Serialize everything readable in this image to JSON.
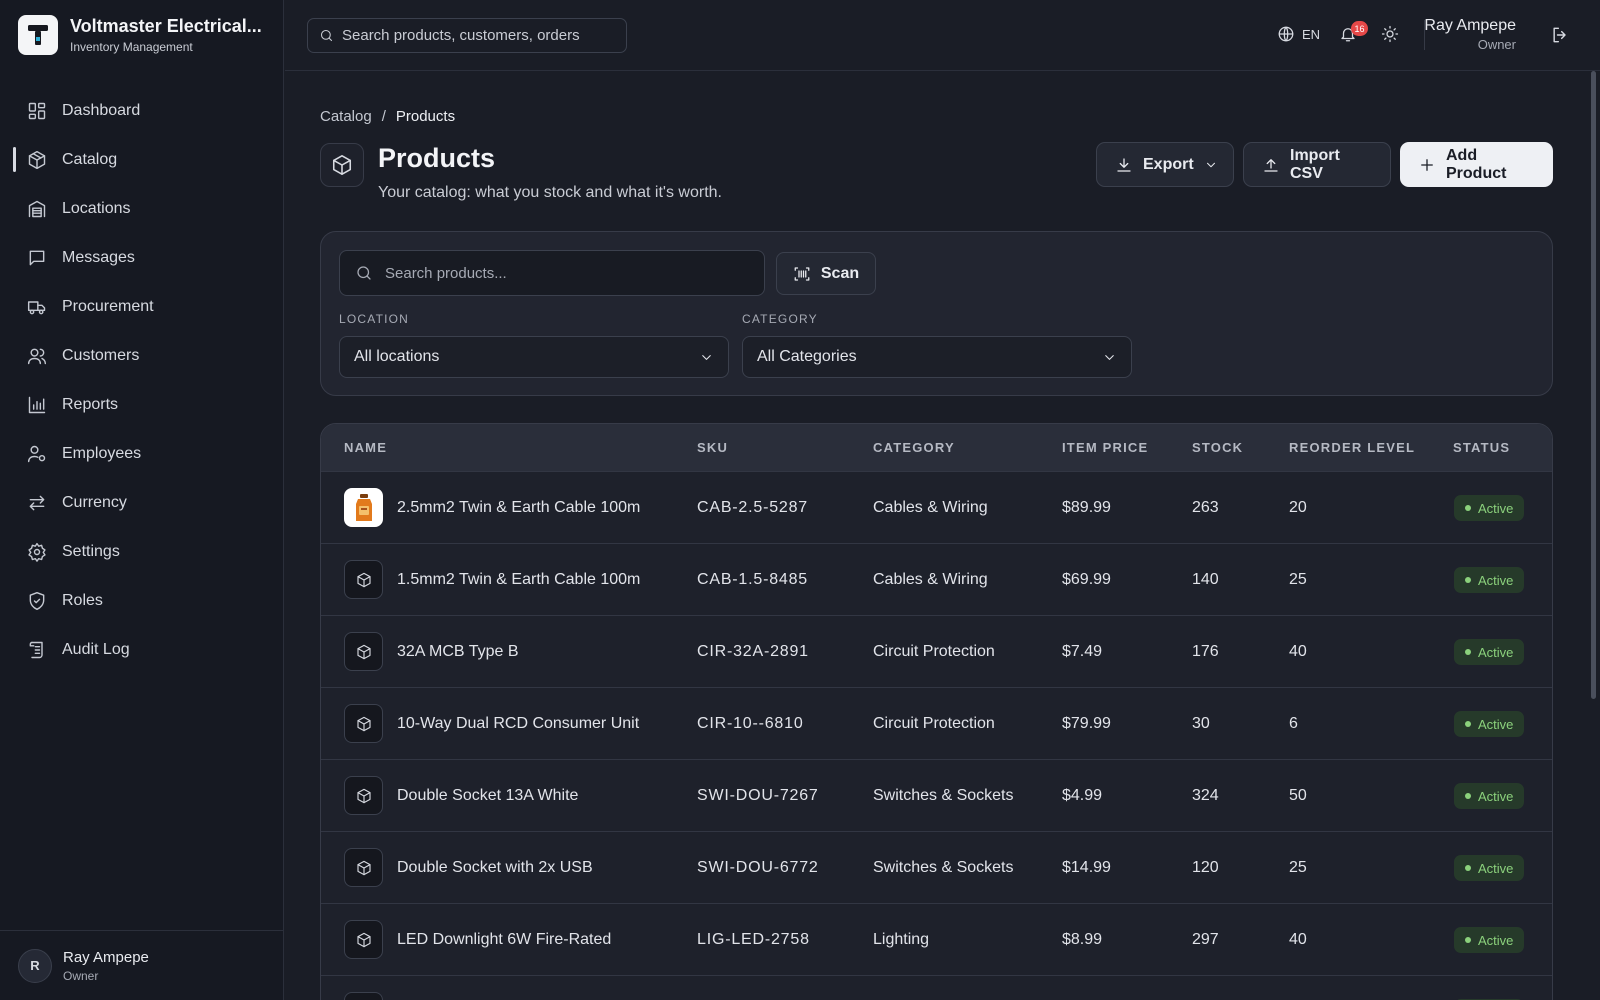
{
  "app": {
    "name": "Voltmaster Electrical...",
    "subtitle": "Inventory Management"
  },
  "sidebar": {
    "items": [
      {
        "label": "Dashboard",
        "icon": "dashboard-icon"
      },
      {
        "label": "Catalog",
        "icon": "box-icon",
        "active": true
      },
      {
        "label": "Locations",
        "icon": "warehouse-icon"
      },
      {
        "label": "Messages",
        "icon": "message-icon"
      },
      {
        "label": "Procurement",
        "icon": "truck-icon"
      },
      {
        "label": "Customers",
        "icon": "users-icon"
      },
      {
        "label": "Reports",
        "icon": "bar-chart-icon"
      },
      {
        "label": "Employees",
        "icon": "user-cog-icon"
      },
      {
        "label": "Currency",
        "icon": "arrows-swap-icon"
      },
      {
        "label": "Settings",
        "icon": "gear-icon"
      },
      {
        "label": "Roles",
        "icon": "shield-icon"
      },
      {
        "label": "Audit Log",
        "icon": "scroll-icon"
      }
    ],
    "user": {
      "initial": "R",
      "name": "Ray Ampepe",
      "role": "Owner"
    }
  },
  "topbar": {
    "search_placeholder": "Search products, customers, orders",
    "language": "EN",
    "notification_count": "16",
    "user_name": "Ray Ampepe",
    "user_role": "Owner"
  },
  "breadcrumb": {
    "parent": "Catalog",
    "separator": "/",
    "current": "Products"
  },
  "page": {
    "title": "Products",
    "subtitle": "Your catalog: what you stock and what it's worth."
  },
  "actions": {
    "export": "Export",
    "import": "Import CSV",
    "add": "Add Product"
  },
  "filters": {
    "search_placeholder": "Search products...",
    "scan": "Scan",
    "location_label": "LOCATION",
    "location_value": "All locations",
    "category_label": "CATEGORY",
    "category_value": "All Categories"
  },
  "table": {
    "columns": [
      "NAME",
      "SKU",
      "CATEGORY",
      "ITEM PRICE",
      "STOCK",
      "REORDER LEVEL",
      "STATUS"
    ],
    "rows": [
      {
        "name": "2.5mm2 Twin & Earth Cable 100m",
        "sku": "CAB-2.5-5287",
        "category": "Cables & Wiring",
        "price": "$89.99",
        "stock": "263",
        "reorder": "20",
        "status": "Active",
        "thumb": "product-photo"
      },
      {
        "name": "1.5mm2 Twin & Earth Cable 100m",
        "sku": "CAB-1.5-8485",
        "category": "Cables & Wiring",
        "price": "$69.99",
        "stock": "140",
        "reorder": "25",
        "status": "Active",
        "thumb": "box-icon"
      },
      {
        "name": "32A MCB Type B",
        "sku": "CIR-32A-2891",
        "category": "Circuit Protection",
        "price": "$7.49",
        "stock": "176",
        "reorder": "40",
        "status": "Active",
        "thumb": "box-icon"
      },
      {
        "name": "10-Way Dual RCD Consumer Unit",
        "sku": "CIR-10--6810",
        "category": "Circuit Protection",
        "price": "$79.99",
        "stock": "30",
        "reorder": "6",
        "status": "Active",
        "thumb": "box-icon"
      },
      {
        "name": "Double Socket 13A White",
        "sku": "SWI-DOU-7267",
        "category": "Switches & Sockets",
        "price": "$4.99",
        "stock": "324",
        "reorder": "50",
        "status": "Active",
        "thumb": "box-icon"
      },
      {
        "name": "Double Socket with 2x USB",
        "sku": "SWI-DOU-6772",
        "category": "Switches & Sockets",
        "price": "$14.99",
        "stock": "120",
        "reorder": "25",
        "status": "Active",
        "thumb": "box-icon"
      },
      {
        "name": "LED Downlight 6W Fire-Rated",
        "sku": "LIG-LED-2758",
        "category": "Lighting",
        "price": "$8.99",
        "stock": "297",
        "reorder": "40",
        "status": "Active",
        "thumb": "box-icon"
      },
      {
        "name": "",
        "sku": "",
        "category": "",
        "price": "",
        "stock": "",
        "reorder": "",
        "status": "Active",
        "thumb": "box-icon"
      }
    ]
  },
  "colors": {
    "background": "#1a1d26",
    "sidebar": "#161922",
    "status_active": "#8bd17c",
    "notification": "#e54848"
  }
}
